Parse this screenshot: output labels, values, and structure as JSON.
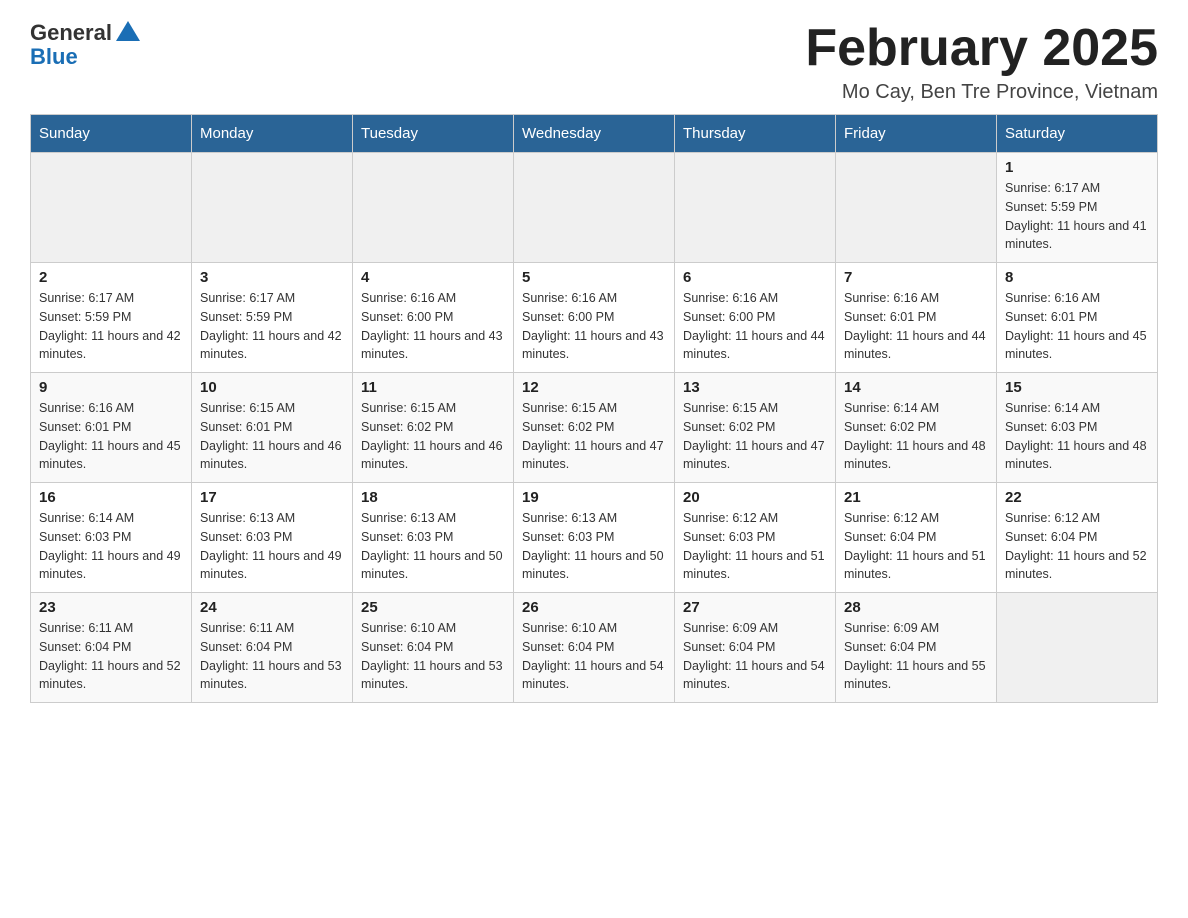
{
  "header": {
    "logo_general": "General",
    "logo_blue": "Blue",
    "month_title": "February 2025",
    "location": "Mo Cay, Ben Tre Province, Vietnam"
  },
  "weekdays": [
    "Sunday",
    "Monday",
    "Tuesday",
    "Wednesday",
    "Thursday",
    "Friday",
    "Saturday"
  ],
  "weeks": [
    [
      {
        "day": "",
        "sunrise": "",
        "sunset": "",
        "daylight": ""
      },
      {
        "day": "",
        "sunrise": "",
        "sunset": "",
        "daylight": ""
      },
      {
        "day": "",
        "sunrise": "",
        "sunset": "",
        "daylight": ""
      },
      {
        "day": "",
        "sunrise": "",
        "sunset": "",
        "daylight": ""
      },
      {
        "day": "",
        "sunrise": "",
        "sunset": "",
        "daylight": ""
      },
      {
        "day": "",
        "sunrise": "",
        "sunset": "",
        "daylight": ""
      },
      {
        "day": "1",
        "sunrise": "Sunrise: 6:17 AM",
        "sunset": "Sunset: 5:59 PM",
        "daylight": "Daylight: 11 hours and 41 minutes."
      }
    ],
    [
      {
        "day": "2",
        "sunrise": "Sunrise: 6:17 AM",
        "sunset": "Sunset: 5:59 PM",
        "daylight": "Daylight: 11 hours and 42 minutes."
      },
      {
        "day": "3",
        "sunrise": "Sunrise: 6:17 AM",
        "sunset": "Sunset: 5:59 PM",
        "daylight": "Daylight: 11 hours and 42 minutes."
      },
      {
        "day": "4",
        "sunrise": "Sunrise: 6:16 AM",
        "sunset": "Sunset: 6:00 PM",
        "daylight": "Daylight: 11 hours and 43 minutes."
      },
      {
        "day": "5",
        "sunrise": "Sunrise: 6:16 AM",
        "sunset": "Sunset: 6:00 PM",
        "daylight": "Daylight: 11 hours and 43 minutes."
      },
      {
        "day": "6",
        "sunrise": "Sunrise: 6:16 AM",
        "sunset": "Sunset: 6:00 PM",
        "daylight": "Daylight: 11 hours and 44 minutes."
      },
      {
        "day": "7",
        "sunrise": "Sunrise: 6:16 AM",
        "sunset": "Sunset: 6:01 PM",
        "daylight": "Daylight: 11 hours and 44 minutes."
      },
      {
        "day": "8",
        "sunrise": "Sunrise: 6:16 AM",
        "sunset": "Sunset: 6:01 PM",
        "daylight": "Daylight: 11 hours and 45 minutes."
      }
    ],
    [
      {
        "day": "9",
        "sunrise": "Sunrise: 6:16 AM",
        "sunset": "Sunset: 6:01 PM",
        "daylight": "Daylight: 11 hours and 45 minutes."
      },
      {
        "day": "10",
        "sunrise": "Sunrise: 6:15 AM",
        "sunset": "Sunset: 6:01 PM",
        "daylight": "Daylight: 11 hours and 46 minutes."
      },
      {
        "day": "11",
        "sunrise": "Sunrise: 6:15 AM",
        "sunset": "Sunset: 6:02 PM",
        "daylight": "Daylight: 11 hours and 46 minutes."
      },
      {
        "day": "12",
        "sunrise": "Sunrise: 6:15 AM",
        "sunset": "Sunset: 6:02 PM",
        "daylight": "Daylight: 11 hours and 47 minutes."
      },
      {
        "day": "13",
        "sunrise": "Sunrise: 6:15 AM",
        "sunset": "Sunset: 6:02 PM",
        "daylight": "Daylight: 11 hours and 47 minutes."
      },
      {
        "day": "14",
        "sunrise": "Sunrise: 6:14 AM",
        "sunset": "Sunset: 6:02 PM",
        "daylight": "Daylight: 11 hours and 48 minutes."
      },
      {
        "day": "15",
        "sunrise": "Sunrise: 6:14 AM",
        "sunset": "Sunset: 6:03 PM",
        "daylight": "Daylight: 11 hours and 48 minutes."
      }
    ],
    [
      {
        "day": "16",
        "sunrise": "Sunrise: 6:14 AM",
        "sunset": "Sunset: 6:03 PM",
        "daylight": "Daylight: 11 hours and 49 minutes."
      },
      {
        "day": "17",
        "sunrise": "Sunrise: 6:13 AM",
        "sunset": "Sunset: 6:03 PM",
        "daylight": "Daylight: 11 hours and 49 minutes."
      },
      {
        "day": "18",
        "sunrise": "Sunrise: 6:13 AM",
        "sunset": "Sunset: 6:03 PM",
        "daylight": "Daylight: 11 hours and 50 minutes."
      },
      {
        "day": "19",
        "sunrise": "Sunrise: 6:13 AM",
        "sunset": "Sunset: 6:03 PM",
        "daylight": "Daylight: 11 hours and 50 minutes."
      },
      {
        "day": "20",
        "sunrise": "Sunrise: 6:12 AM",
        "sunset": "Sunset: 6:03 PM",
        "daylight": "Daylight: 11 hours and 51 minutes."
      },
      {
        "day": "21",
        "sunrise": "Sunrise: 6:12 AM",
        "sunset": "Sunset: 6:04 PM",
        "daylight": "Daylight: 11 hours and 51 minutes."
      },
      {
        "day": "22",
        "sunrise": "Sunrise: 6:12 AM",
        "sunset": "Sunset: 6:04 PM",
        "daylight": "Daylight: 11 hours and 52 minutes."
      }
    ],
    [
      {
        "day": "23",
        "sunrise": "Sunrise: 6:11 AM",
        "sunset": "Sunset: 6:04 PM",
        "daylight": "Daylight: 11 hours and 52 minutes."
      },
      {
        "day": "24",
        "sunrise": "Sunrise: 6:11 AM",
        "sunset": "Sunset: 6:04 PM",
        "daylight": "Daylight: 11 hours and 53 minutes."
      },
      {
        "day": "25",
        "sunrise": "Sunrise: 6:10 AM",
        "sunset": "Sunset: 6:04 PM",
        "daylight": "Daylight: 11 hours and 53 minutes."
      },
      {
        "day": "26",
        "sunrise": "Sunrise: 6:10 AM",
        "sunset": "Sunset: 6:04 PM",
        "daylight": "Daylight: 11 hours and 54 minutes."
      },
      {
        "day": "27",
        "sunrise": "Sunrise: 6:09 AM",
        "sunset": "Sunset: 6:04 PM",
        "daylight": "Daylight: 11 hours and 54 minutes."
      },
      {
        "day": "28",
        "sunrise": "Sunrise: 6:09 AM",
        "sunset": "Sunset: 6:04 PM",
        "daylight": "Daylight: 11 hours and 55 minutes."
      },
      {
        "day": "",
        "sunrise": "",
        "sunset": "",
        "daylight": ""
      }
    ]
  ]
}
